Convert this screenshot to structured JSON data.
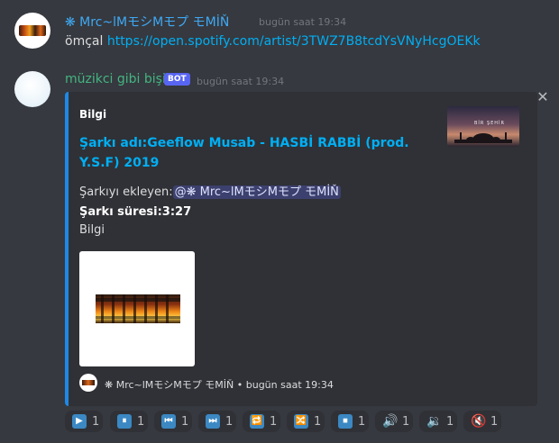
{
  "message1": {
    "username": "❋ Mrc~lMモシMモプ   モMİŇ",
    "timestamp": "bugün saat 19:34",
    "text_prefix": "ömçal ",
    "link": "https://open.spotify.com/artist/3TWZ7B8tcdYsVNyHcgOEKk"
  },
  "message2": {
    "username": "müzikci gibi bişi",
    "bot_badge": "BOT",
    "timestamp": "bugün saat 19:34",
    "embed": {
      "author": "Bilgi",
      "title": "Şarkı adı:Geeflow Musab - HASBİ RABBİ (prod. Y.S.F) 2019",
      "added_by_label": "Şarkıyı ekleyen:",
      "added_by_mention": "@❋ Mrc~lMモシMモプ モMİŇ",
      "duration": "Şarkı süresi:3:27",
      "description": "Bilgi",
      "thumbnail_text": "BİR ŞEHİR",
      "footer_user": "❋ Mrc~lMモシMモプ   モMİŇ",
      "footer_timestamp": "• bugün saat 19:34",
      "accent_color": "#1e88e5"
    }
  },
  "reactions": [
    {
      "icon": "play-icon",
      "glyph": "▶",
      "count": "1"
    },
    {
      "icon": "pause-icon",
      "glyph": "⏸",
      "count": "1"
    },
    {
      "icon": "previous-icon",
      "glyph": "⏮",
      "count": "1"
    },
    {
      "icon": "next-icon",
      "glyph": "⏭",
      "count": "1"
    },
    {
      "icon": "repeat-icon",
      "glyph": "🔁",
      "count": "1"
    },
    {
      "icon": "shuffle-icon",
      "glyph": "🔀",
      "count": "1"
    },
    {
      "icon": "stop-icon",
      "glyph": "⏹",
      "count": "1"
    },
    {
      "icon": "volume-up-icon",
      "glyph": "🔊",
      "count": "1"
    },
    {
      "icon": "volume-down-icon",
      "glyph": "🔉",
      "count": "1"
    },
    {
      "icon": "mute-icon",
      "glyph": "🔇",
      "count": "1"
    }
  ],
  "colors": {
    "background": "#36393f",
    "link": "#00aff4",
    "user_name": "#3fa9f5",
    "bot_name": "#43b581",
    "bot_badge": "#5865f2"
  }
}
